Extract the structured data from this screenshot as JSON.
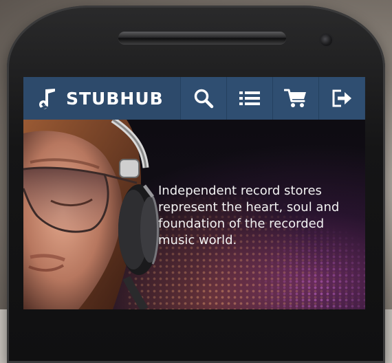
{
  "app": {
    "brand_name": "STUBHUB",
    "brand_icon": "music-note-icon"
  },
  "navbar": {
    "background": "#2d4a6b",
    "buttons": [
      {
        "icon": "search-icon",
        "name": "search-button"
      },
      {
        "icon": "list-icon",
        "name": "menu-list-button"
      },
      {
        "icon": "cart-icon",
        "name": "cart-button"
      },
      {
        "icon": "logout-icon",
        "name": "logout-button"
      }
    ]
  },
  "hero": {
    "tagline": "Independent record stores represent the heart, soul and foundation of the recorded music world."
  }
}
